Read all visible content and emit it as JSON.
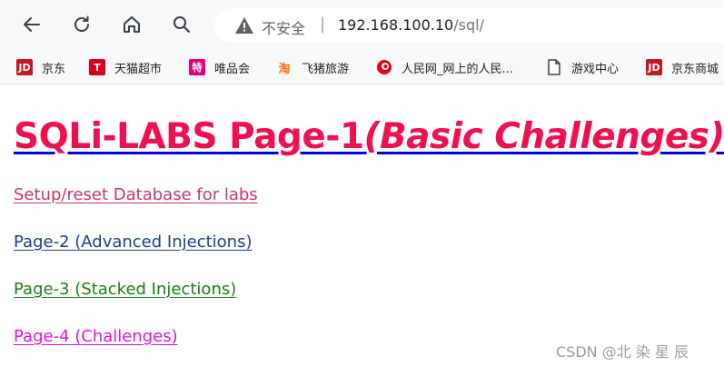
{
  "browser": {
    "security_label": "不安全",
    "url_host": "192.168.100.10",
    "url_path": "/sql/",
    "icons": [
      "back-icon",
      "reload-icon",
      "home-icon",
      "search-icon",
      "warning-icon"
    ]
  },
  "bookmarks": [
    {
      "label": "京东",
      "icon_text": "JD",
      "color": "#c81623"
    },
    {
      "label": "天猫超市",
      "icon_text": "T",
      "color": "#d9001b"
    },
    {
      "label": "唯品会",
      "icon_text": "特",
      "color": "#e4007f"
    },
    {
      "label": "飞猪旅游",
      "icon_text": "淘",
      "color": "#ff6a00"
    },
    {
      "label": "人民网_网上的人民...",
      "icon_text": "",
      "color": "#e60012"
    },
    {
      "label": "游戏中心",
      "icon_text": "",
      "color": "#ffffff"
    },
    {
      "label": "京东商城",
      "icon_text": "JD",
      "color": "#c81623"
    }
  ],
  "content": {
    "title_main": "SQLi-LABS Page-1",
    "title_sub": "(Basic Challenges)",
    "links": [
      {
        "text": "Setup/reset Database for labs",
        "color": "#cc3366"
      },
      {
        "text": "Page-2 (Advanced Injections)",
        "color": "#1d3a94"
      },
      {
        "text": "Page-3 (Stacked Injections)",
        "color": "#148214"
      },
      {
        "text": "Page-4 (Challenges)",
        "color": "#e212e2"
      }
    ]
  },
  "watermark": "CSDN @北 染 星 辰"
}
